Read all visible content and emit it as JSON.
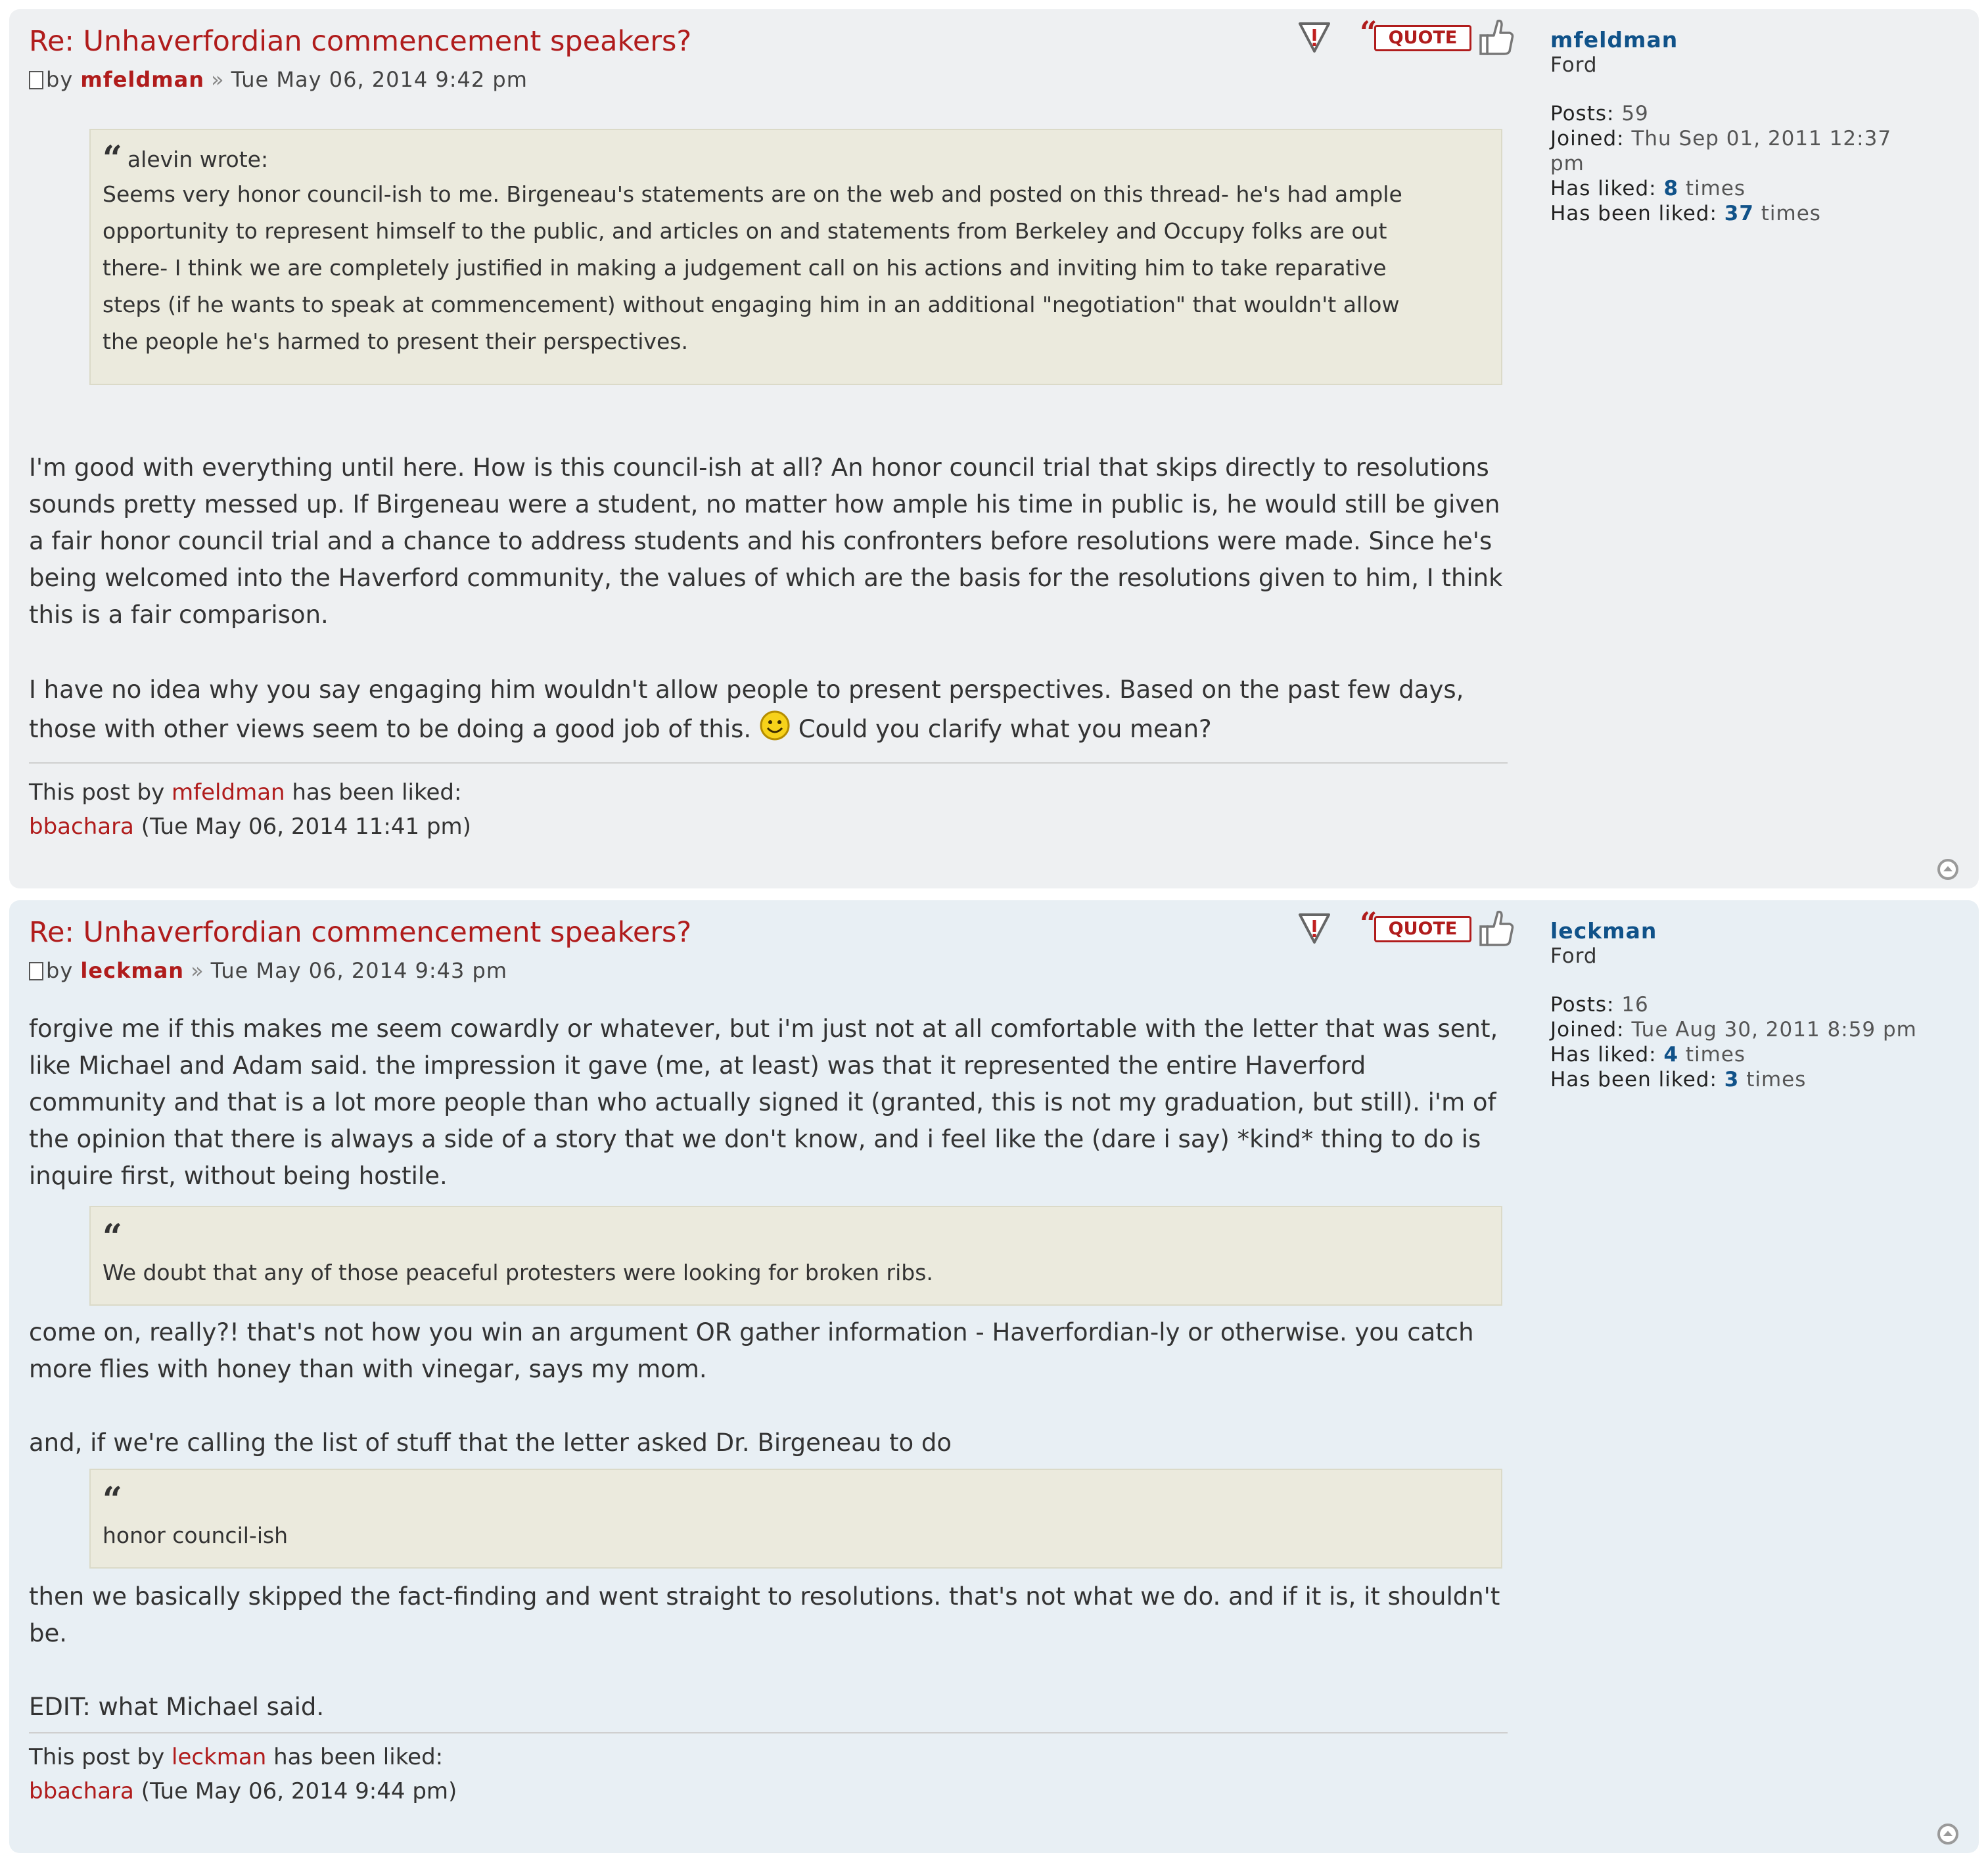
{
  "posts": [
    {
      "title": "Re: Unhaverfordian commencement speakers?",
      "by_label": "by",
      "author": "mfeldman",
      "date": "Tue May 06, 2014 9:42 pm",
      "quote_button": "QUOTE",
      "quote": {
        "cite": "alevin wrote:",
        "lines": [
          "Seems very honor council-ish to me. Birgeneau's statements are on the web and posted on this thread- he's had ample",
          "opportunity to represent himself to the public, and articles on and statements from Berkeley and Occupy folks are out",
          "there- I think we are completely justified in making a judgement call on his actions and inviting him to take reparative",
          "steps (if he wants to speak at commencement) without engaging him in an additional \"negotiation\" that wouldn't allow",
          "the people he's harmed to present their perspectives."
        ]
      },
      "paragraph1": [
        "I'm good with everything until here. How is this council-ish at all? An honor council trial that skips directly to resolutions",
        "sounds pretty messed up. If Birgeneau were a student, no matter how ample his time in public is, he would still be given",
        "a fair honor council trial and a chance to address students and his confronters before resolutions were made. Since he's",
        "being welcomed into the Haverford community, the values of which are the basis for the resolutions given to him, I think",
        "this is a fair comparison."
      ],
      "paragraph2_line1": "I have no idea why you say engaging him wouldn't allow people to present perspectives. Based on the past few days,",
      "paragraph2_line2_before": "those with other views seem to be doing a good job of this.",
      "paragraph2_line2_after": "Could you clarify what you mean?",
      "liked_prefix": "This post by",
      "liked_suffix": "has been liked:",
      "liked_user": "bbachara",
      "liked_date": "(Tue May 06, 2014 11:41 pm)",
      "profile": {
        "name": "mfeldman",
        "rank": "Ford",
        "posts_label": "Posts:",
        "posts": "59",
        "joined_label": "Joined:",
        "joined_line1": "Thu Sep 01, 2011 12:37",
        "joined_line2": "pm",
        "has_liked_label": "Has liked:",
        "has_liked": "8",
        "has_been_liked_label": "Has been liked:",
        "has_been_liked": "37",
        "times": "times"
      }
    },
    {
      "title": "Re: Unhaverfordian commencement speakers?",
      "by_label": "by",
      "author": "leckman",
      "date": "Tue May 06, 2014 9:43 pm",
      "quote_button": "QUOTE",
      "intro": [
        "forgive me if this makes me seem cowardly or whatever, but i'm just not at all comfortable with the letter that was sent,",
        "like Michael and Adam said. the impression it gave (me, at least) was that it represented the entire Haverford",
        "community and that is a lot more people than who actually signed it (granted, this is not my graduation, but still). i'm of",
        "the opinion that there is always a side of a story that we don't know, and i feel like the (dare i say) *kind* thing to do is",
        "inquire first, without being hostile."
      ],
      "quote1": "We doubt that any of those peaceful protesters were looking for broken ribs.",
      "middle": [
        "come on, really?! that's not how you win an argument OR gather information - Haverfordian-ly or otherwise. you catch",
        "more flies with honey than with vinegar, says my mom."
      ],
      "middle2": "and, if we're calling the list of stuff that the letter asked Dr. Birgeneau to do",
      "quote2": "honor council-ish",
      "after": [
        "then we basically skipped the fact-finding and went straight to resolutions. that's not what we do. and if it is, it shouldn't",
        "be."
      ],
      "edit": "EDIT: what Michael said.",
      "liked_prefix": "This post by",
      "liked_suffix": "has been liked:",
      "liked_user": "bbachara",
      "liked_date": "(Tue May 06, 2014 9:44 pm)",
      "profile": {
        "name": "leckman",
        "rank": "Ford",
        "posts_label": "Posts:",
        "posts": "16",
        "joined_label": "Joined:",
        "joined_line1": "Tue Aug 30, 2011 8:59 pm",
        "has_liked_label": "Has liked:",
        "has_liked": "4",
        "has_been_liked_label": "Has been liked:",
        "has_been_liked": "3",
        "times": "times"
      }
    }
  ],
  "icons": {
    "report": "report-icon",
    "quote": "quote-icon",
    "like": "thumbs-up-icon",
    "top": "back-to-top-icon",
    "smiley": "smiley-icon",
    "post": "post-document-icon"
  },
  "colors": {
    "title": "#b01c1c",
    "username": "#105289",
    "quote_bg": "#ebeadd",
    "post1_bg": "#eef0f2",
    "post2_bg": "#e8eff4"
  }
}
